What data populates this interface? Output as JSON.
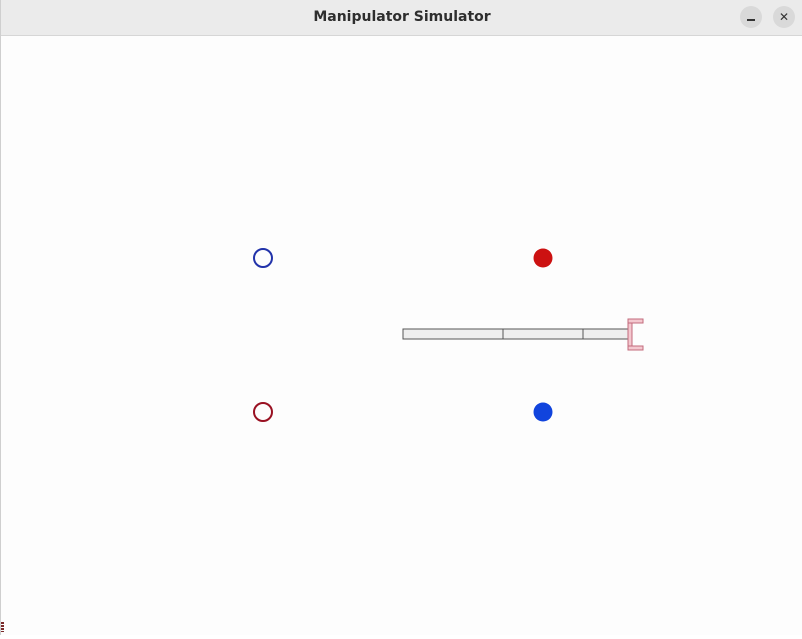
{
  "window": {
    "title": "Manipulator Simulator",
    "minimize_glyph": "–",
    "close_glyph": "✕"
  },
  "scene": {
    "targets": [
      {
        "name": "target-blue-outline",
        "style": "outline",
        "color": "#2233aa"
      },
      {
        "name": "target-red-filled",
        "style": "filled",
        "color": "#cc1111"
      },
      {
        "name": "target-red-outline",
        "style": "outline",
        "color": "#991122"
      },
      {
        "name": "target-blue-filled",
        "style": "filled",
        "color": "#1144dd"
      }
    ],
    "arm": {
      "link_color": "#eeeeee",
      "link_stroke": "#555555",
      "gripper_color": "#f4c8cf",
      "gripper_stroke": "#c26a7c",
      "link_count": 3
    }
  }
}
